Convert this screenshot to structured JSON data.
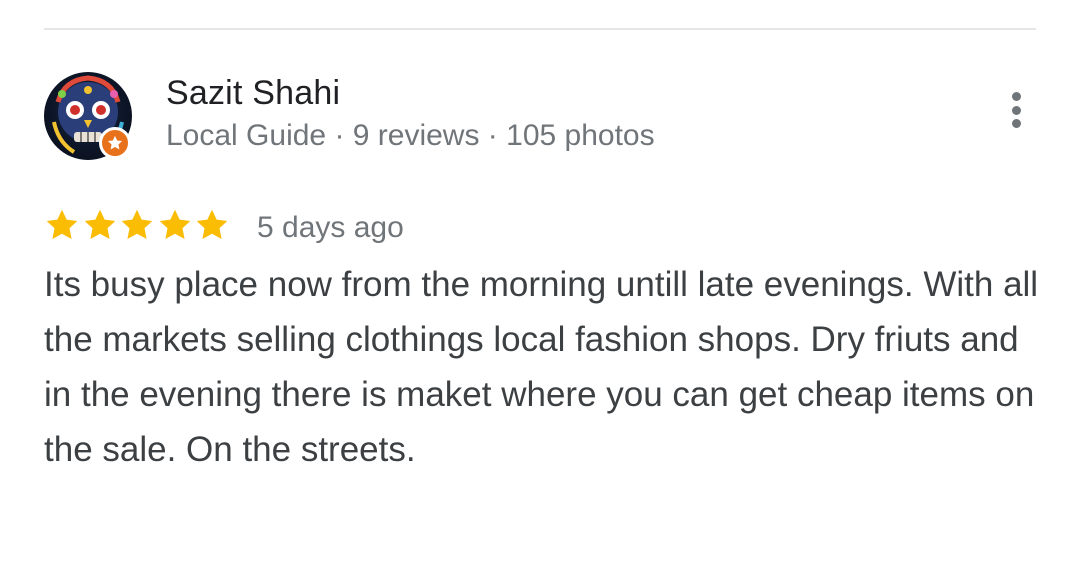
{
  "reviewer": {
    "name": "Sazit Shahi",
    "meta": "Local Guide · 9 reviews · 105 photos",
    "avatar_icon": "skull-art-avatar",
    "badge_icon": "local-guide-star-badge",
    "badge_color": "#e8711c"
  },
  "review": {
    "rating": 5,
    "max_rating": 5,
    "star_color": "#fbbc04",
    "date": "5 days ago",
    "text": "Its busy  place now from the morning untill late evenings. With all the markets selling clothings local fashion shops. Dry friuts and in the evening there is maket where you can get cheap items on the sale. On the streets."
  },
  "actions": {
    "more_icon": "more-vert-icon"
  }
}
